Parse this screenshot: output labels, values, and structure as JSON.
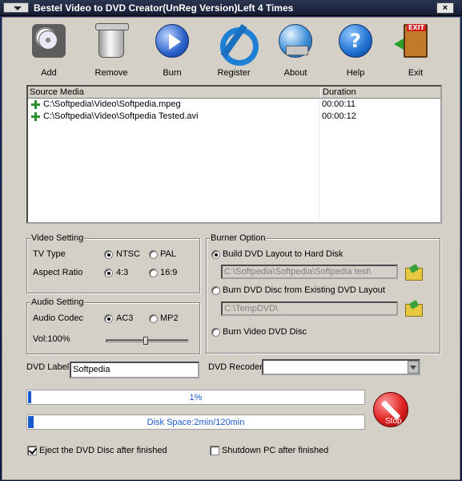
{
  "window": {
    "title": "Bestel Video to DVD Creator(UnReg Version)Left 4 Times",
    "close_glyph": "×"
  },
  "toolbar": [
    {
      "key": "add",
      "label": "Add",
      "icon": "add-media-icon"
    },
    {
      "key": "remove",
      "label": "Remove",
      "icon": "trash-can-icon"
    },
    {
      "key": "burn",
      "label": "Burn",
      "icon": "play-burn-icon"
    },
    {
      "key": "register",
      "label": "Register",
      "icon": "register-icon"
    },
    {
      "key": "about",
      "label": "About",
      "icon": "about-globe-icon"
    },
    {
      "key": "help",
      "label": "Help",
      "icon": "help-icon"
    },
    {
      "key": "exit",
      "label": "Exit",
      "icon": "exit-door-icon"
    }
  ],
  "media": {
    "col_source": "Source Media",
    "col_duration": "Duration",
    "rows": [
      {
        "path": "C:\\Softpedia\\Video\\Softpedia.mpeg",
        "duration": "00:00:11"
      },
      {
        "path": "C:\\Softpedia\\Video\\Softpedia Tested.avi",
        "duration": "00:00:12"
      }
    ]
  },
  "video_setting": {
    "title": "Video Setting",
    "tv_type_label": "TV Type",
    "ntsc": "NTSC",
    "pal": "PAL",
    "tv_selected": "NTSC",
    "aspect_label": "Aspect Ratio",
    "aspect_43": "4:3",
    "aspect_169": "16:9",
    "aspect_selected": "4:3"
  },
  "audio_setting": {
    "title": "Audio Setting",
    "codec_label": "Audio Codec",
    "ac3": "AC3",
    "mp2": "MP2",
    "codec_selected": "AC3",
    "volume_label": "Vol:100%",
    "volume_level": 0.5
  },
  "burner_option": {
    "title": "Burner Option",
    "build_label": "Build DVD Layout to Hard Disk",
    "build_path": "C:\\Softpedia\\Softpedia\\Softpedia test\\",
    "burn_existing_label": "Burn DVD Disc from Existing DVD Layout",
    "existing_path": "C:\\TempDVD\\",
    "burn_video_label": "Burn Video DVD Disc",
    "selected": "build"
  },
  "dvd_label": {
    "label": "DVD Label",
    "value": "Softpedia"
  },
  "dvd_recorder": {
    "label": "DVD Recoder",
    "value": ""
  },
  "progress": {
    "text": "1%",
    "fraction": 0.01
  },
  "disk_space": {
    "text": "Disk Space:2min/120min",
    "fraction": 0.0167
  },
  "stop": {
    "label": "Stop"
  },
  "options": {
    "eject_label": "Eject the DVD Disc after finished",
    "eject_checked": true,
    "shutdown_label": "Shutdown PC after finished",
    "shutdown_checked": false
  },
  "colors": {
    "accent": "#1a5cd0",
    "panel": "#d4d0c8",
    "stop": "#e02020"
  }
}
